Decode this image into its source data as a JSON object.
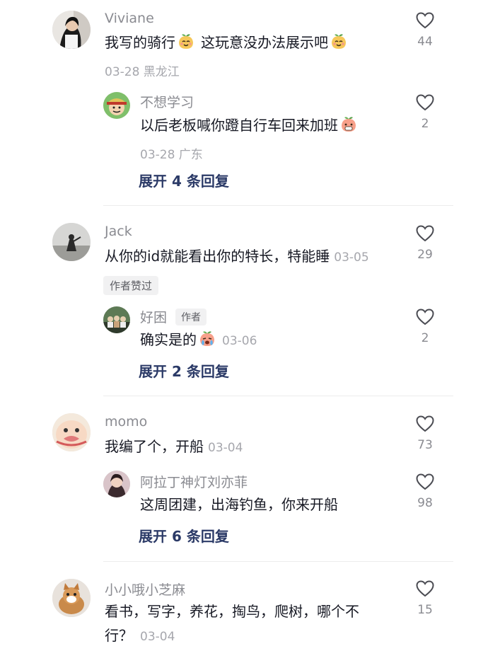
{
  "comments": [
    {
      "username": "Viviane",
      "text_a": "我写的骑行",
      "text_b": "这玩意没办法展示吧",
      "meta": "03-28 黑龙江",
      "likes": "44",
      "reply": {
        "username": "不想学习",
        "text": "以后老板喊你蹬自行车回来加班",
        "meta": "03-28 广东",
        "likes": "2"
      },
      "expand": "展开 4 条回复"
    },
    {
      "username": "Jack",
      "text": "从你的id就能看出你的特长，特能睡",
      "date": "03-05",
      "likes": "29",
      "badge": "作者赞过",
      "reply": {
        "username": "好困",
        "author_tag": "作者",
        "text": "确实是的",
        "date": "03-06",
        "likes": "2"
      },
      "expand": "展开 2 条回复"
    },
    {
      "username": "momo",
      "text": "我编了个，开船",
      "date": "03-04",
      "likes": "73",
      "reply": {
        "username": "阿拉丁神灯刘亦菲",
        "text": "这周团建，出海钓鱼，你来开船",
        "likes": "98"
      },
      "expand": "展开 6 条回复"
    },
    {
      "username": "小小哦小芝麻",
      "text_line1": "看书，写字，养花，掏鸟，爬树，哪个不",
      "text_line2": "行？",
      "date": "03-04",
      "likes": "15"
    }
  ],
  "colors": {
    "text": "#161823",
    "secondary": "#8a8b91",
    "expand": "#2b3a67",
    "divider": "#ececec"
  },
  "icons": {
    "like": "heart-outline-icon",
    "emoji_smile": "peach-smile-emoji",
    "emoji_blush": "peach-blush-emoji",
    "emoji_cry": "peach-cry-emoji"
  }
}
